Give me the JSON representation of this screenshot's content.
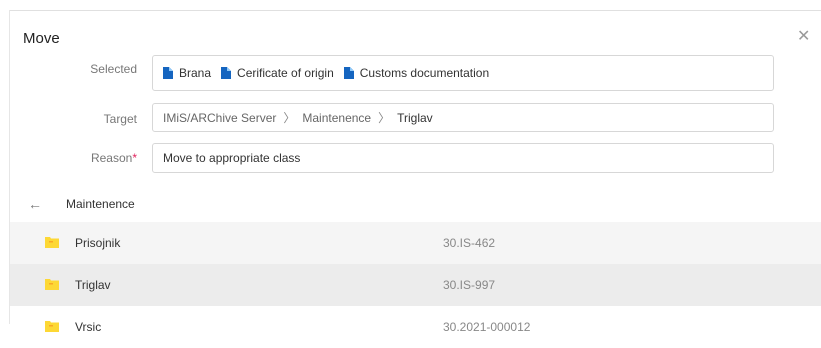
{
  "dialog": {
    "title": "Move"
  },
  "form": {
    "selected_label": "Selected",
    "selected_items": [
      "Brana",
      "Cerificate of origin",
      "Customs documentation"
    ],
    "target_label": "Target",
    "target_path": [
      "IMiS/ARChive Server",
      "Maintenence",
      "Triglav"
    ],
    "reason_label": "Reason",
    "reason_required": "*",
    "reason_value": "Move to appropriate class"
  },
  "browser": {
    "current_folder": "Maintenence",
    "rows": [
      {
        "name": "Prisojnik",
        "code": "30.IS-462"
      },
      {
        "name": "Triglav",
        "code": "30.IS-997"
      },
      {
        "name": "Vrsic",
        "code": "30.2021-000012"
      }
    ]
  },
  "colors": {
    "accent_doc": "#1565c0",
    "folder": "#fdd835",
    "folder_dark": "#f9a825",
    "row_alt": "#f5f5f5",
    "row_selected": "#ececec",
    "required": "#e0245e"
  },
  "icons": {
    "close": "close-icon",
    "back": "arrow-left-icon",
    "document": "document-icon",
    "folder": "folder-icon",
    "separator": "chevron-right-icon"
  }
}
